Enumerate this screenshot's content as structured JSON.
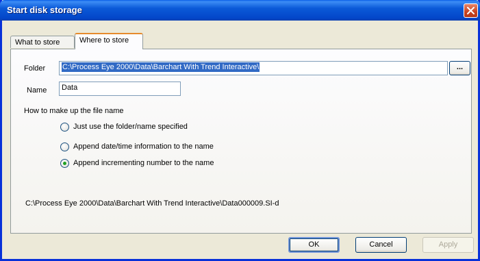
{
  "window": {
    "title": "Start disk storage"
  },
  "tabs": [
    {
      "label": "What to store",
      "active": false
    },
    {
      "label": "Where to store",
      "active": true
    }
  ],
  "form": {
    "folder_label": "Folder",
    "folder_value": "C:\\Process Eye 2000\\Data\\Barchart With Trend Interactive\\",
    "browse_label": "...",
    "name_label": "Name",
    "name_value": "Data",
    "filename_section_label": "How to make up the file name",
    "options": [
      {
        "label": "Just use the folder/name specified",
        "selected": false
      },
      {
        "label": "Append date/time information to the name",
        "selected": false
      },
      {
        "label": "Append incrementing number to the name",
        "selected": true
      }
    ],
    "preview_path": "C:\\Process Eye 2000\\Data\\Barchart With Trend Interactive\\Data000009.SI-d"
  },
  "buttons": {
    "ok": "OK",
    "cancel": "Cancel",
    "apply": "Apply"
  },
  "colors": {
    "titlebar": "#0a5fe8",
    "selection": "#316ac5",
    "radio_dot": "#21a121",
    "tab_highlight": "#e68b2c"
  }
}
